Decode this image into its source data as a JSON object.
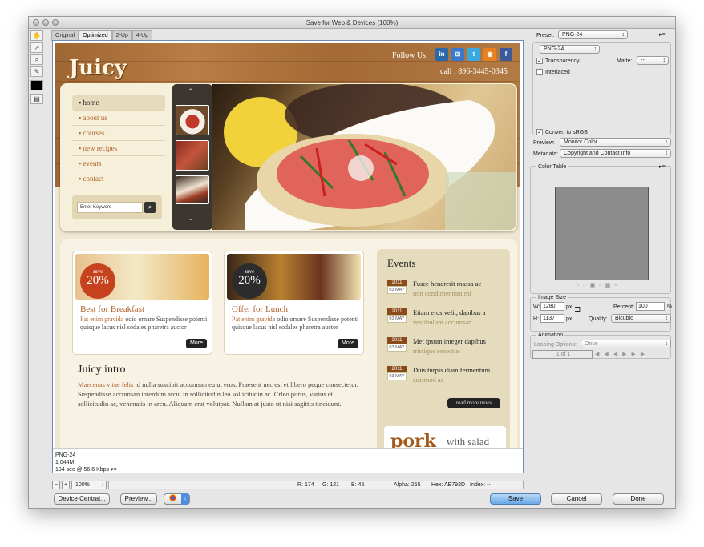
{
  "window": {
    "title": "Save for Web & Devices (100%)"
  },
  "view_tabs": [
    "Original",
    "Optimized",
    "2-Up",
    "4-Up"
  ],
  "tools": [
    "hand-tool",
    "slice-select-tool",
    "zoom-tool",
    "eyedropper-tool",
    "eyedropper-color",
    "toggle-slices"
  ],
  "site": {
    "logo": "Juicy",
    "follow_us": "Follow Us:",
    "social": [
      "in",
      "⊞",
      "t",
      "◉",
      "f"
    ],
    "call": "call : 896-3445-0345",
    "menu": [
      "home",
      "about us",
      "courses",
      "new recipes",
      "events",
      "contact"
    ],
    "search_placeholder": "Enter Keyword",
    "cards": [
      {
        "badge_save": "save",
        "badge_pct": "20%",
        "title": "Best for Breakfast",
        "text_link": "Pat enim gravida",
        "text": " odio ornare Suspendisse potenti quisque lacus nisl sodales pharetra auctor",
        "more": "More"
      },
      {
        "badge_save": "save",
        "badge_pct": "20%",
        "title": "Offer for Lunch",
        "text_link": "Pat enim gravida",
        "text": " odio ornare Suspendisse potenti quisque lacus nisl sodales pharetra auctor",
        "more": "More"
      }
    ],
    "intro_title": "Juicy intro",
    "intro_link": "Maecenas vitae felis",
    "intro_text": " id nulla suscipit accumsan eu ut eros. Praesent nec est et libero peque consectetur. Suspendisse accumsan interdum arcu, in sollicitudin leo sollicitudin ac. Crleo purus, varius et sollicitudin ac, venenatis in arcu. Aliquam erat volutpat. Nullam at justo ut nisi sagittis tincidunt.",
    "events_title": "Events",
    "events": [
      {
        "year": "2011",
        "date": "03 MAY",
        "title": "Fusce hendrerit massa ac",
        "sub": "non condimentum mi"
      },
      {
        "year": "2011",
        "date": "03 MAY",
        "title": "Etiam eros velit, dapibus a",
        "sub": "vestibulum accumsan"
      },
      {
        "year": "2011",
        "date": "03 MAY",
        "title": "Met ipsum integer dapibus",
        "sub": "tristique senectus"
      },
      {
        "year": "2011",
        "date": "03 MAY",
        "title": "Duis turpis diam fermentum",
        "sub": "euismod ac"
      }
    ],
    "read_more": "read more news",
    "pork_text": "pork",
    "pork_sub": "with salad"
  },
  "optimize_info": {
    "format": "PNG-24",
    "size": "1,044M",
    "time": "194 sec @ 56.6 Kbps"
  },
  "bottom": {
    "zoom": "100%",
    "r": "R: 174",
    "g": "G: 121",
    "b": "B: 45",
    "alpha": "Alpha: 255",
    "hex": "Hex: AE792D",
    "index": "Index: --"
  },
  "buttons": {
    "device_central": "Device Central...",
    "preview": "Preview...",
    "save": "Save",
    "cancel": "Cancel",
    "done": "Done"
  },
  "panel": {
    "preset_label": "Preset:",
    "preset_value": "PNG-24",
    "format_value": "PNG-24",
    "transparency": "Transparency",
    "matte_label": "Matte:",
    "matte_value": "--",
    "interlaced": "Interlaced",
    "convert_srgb": "Convert to sRGB",
    "preview_label": "Preview:",
    "preview_value": "Monitor Color",
    "metadata_label": "Metadata:",
    "metadata_value": "Copyright and Contact Info",
    "color_table": "Color Table",
    "image_size": "Image Size",
    "w_label": "W:",
    "w_value": "1280",
    "w_unit": "px",
    "h_label": "H:",
    "h_value": "1137",
    "h_unit": "px",
    "percent_label": "Percent:",
    "percent_value": "100",
    "percent_unit": "%",
    "quality_label": "Quality:",
    "quality_value": "Bicubic",
    "animation": "Animation",
    "looping_label": "Looping Options:",
    "looping_value": "Once",
    "frame": "1 of 1"
  }
}
